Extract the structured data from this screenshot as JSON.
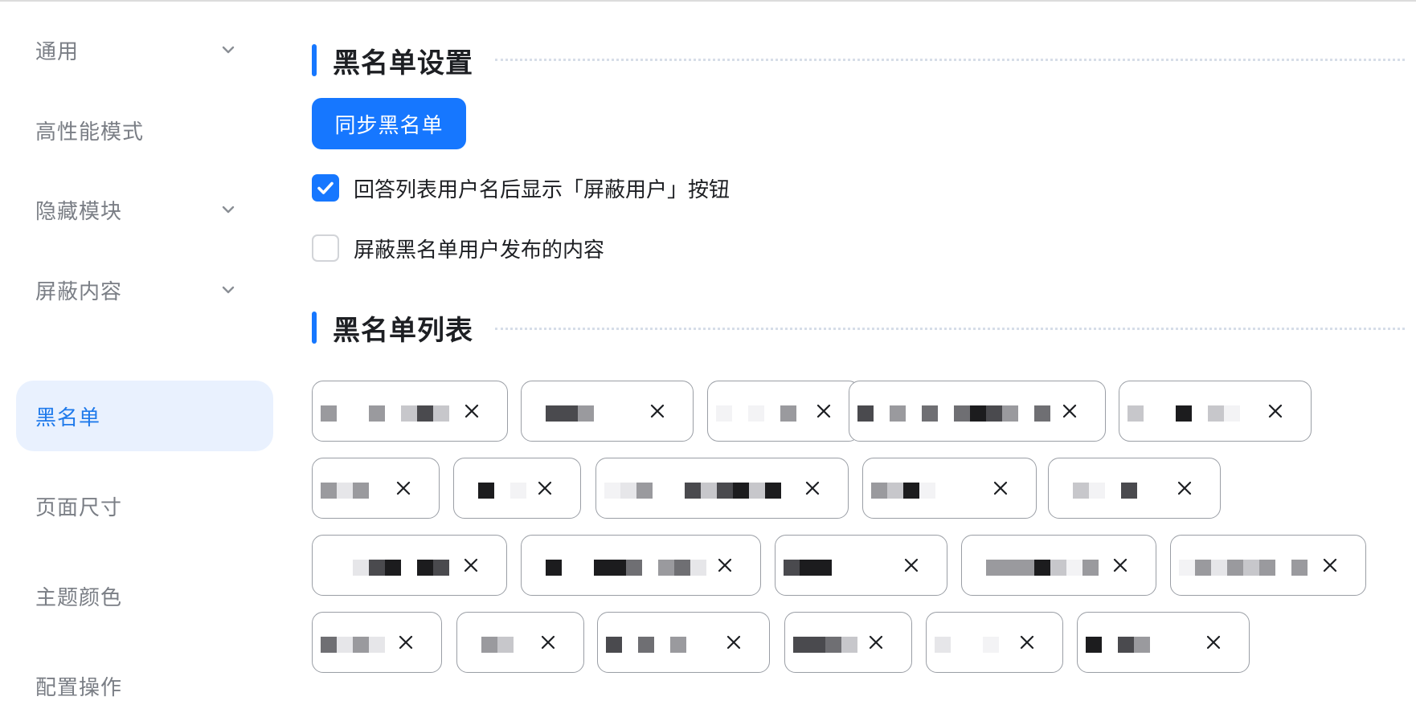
{
  "sidebar": {
    "items": [
      {
        "label": "通用",
        "has_chevron": true,
        "active": false
      },
      {
        "label": "高性能模式",
        "has_chevron": false,
        "active": false
      },
      {
        "label": "隐藏模块",
        "has_chevron": true,
        "active": false
      },
      {
        "label": "屏蔽内容",
        "has_chevron": true,
        "active": false
      },
      {
        "label": "黑名单",
        "has_chevron": false,
        "active": true
      },
      {
        "label": "页面尺寸",
        "has_chevron": false,
        "active": false
      },
      {
        "label": "主题颜色",
        "has_chevron": false,
        "active": false
      },
      {
        "label": "配置操作",
        "has_chevron": false,
        "active": false
      }
    ]
  },
  "blacklist_settings": {
    "title": "黑名单设置",
    "sync_button": "同步黑名单",
    "options": [
      {
        "label": "回答列表用户名后显示「屏蔽用户」按钮",
        "checked": true
      },
      {
        "label": "屏蔽黑名单用户发布的内容",
        "checked": false
      }
    ]
  },
  "blacklist_list": {
    "title": "黑名单列表",
    "tags_note": "user names are pixelated/redacted in the screenshot",
    "remove_icon": "close-icon",
    "tag_count": 21
  },
  "colors": {
    "accent": "#1677ff",
    "active_bg": "#e9f1fe",
    "active_text": "#1f7aeb",
    "muted_text": "#7a7e85"
  }
}
